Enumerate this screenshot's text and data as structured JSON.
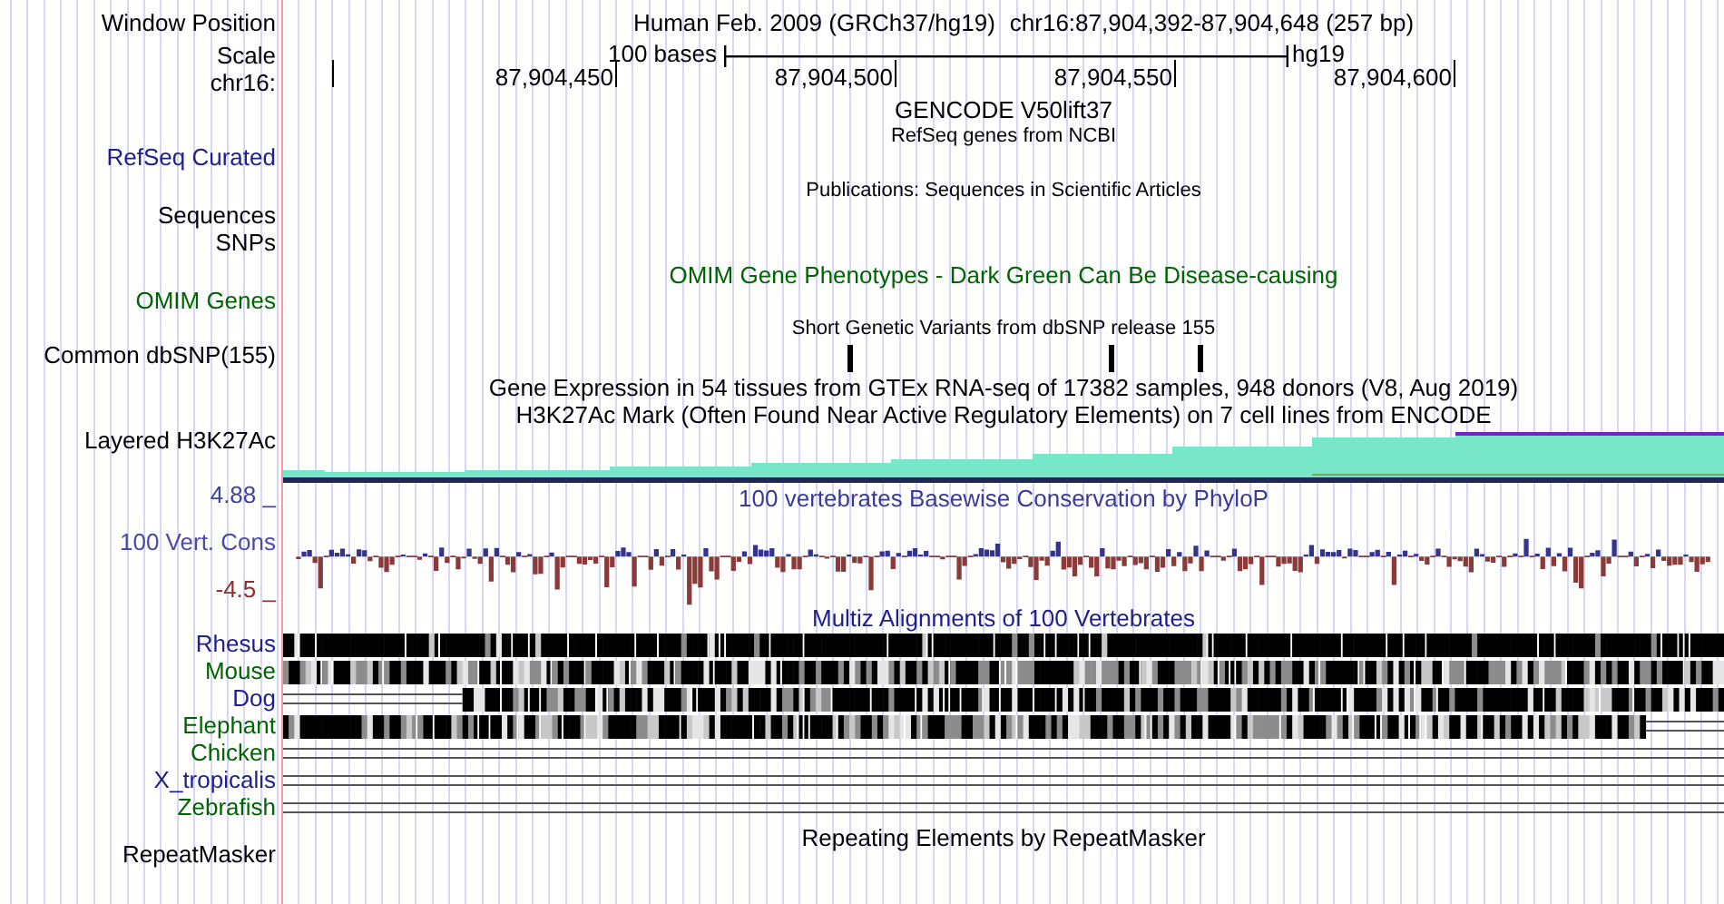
{
  "header": {
    "position_label": "Window Position",
    "assembly": "Human Feb. 2009 (GRCh37/hg19)",
    "position": "chr16:87,904,392-87,904,648 (257 bp)",
    "scale_label": "Scale",
    "scale_text": "100 bases",
    "scale_db": "hg19",
    "chrom_label": "chr16:",
    "ticks": [
      "87,904,450",
      "87,904,500",
      "87,904,550",
      "87,904,600"
    ]
  },
  "tracks": [
    {
      "kind": "gencode",
      "title": "GENCODE V50lift37"
    },
    {
      "kind": "refseq",
      "label": "RefSeq Curated",
      "color": "#20208b",
      "title": "RefSeq genes from NCBI"
    },
    {
      "kind": "pubs",
      "title": "Publications: Sequences in Scientific Articles"
    },
    {
      "kind": "plain",
      "label": "Sequences"
    },
    {
      "kind": "plain",
      "label": "SNPs"
    },
    {
      "kind": "omim",
      "label": "OMIM Genes",
      "color": "#006400",
      "title": "OMIM Gene Phenotypes - Dark Green Can Be Disease-causing"
    },
    {
      "kind": "dbsnp",
      "label": "Common dbSNP(155)",
      "title": "Short Genetic Variants from dbSNP release 155"
    },
    {
      "kind": "gtex",
      "title": "Gene Expression in 54 tissues from GTEx RNA-seq of 17382 samples, 948 donors (V8, Aug 2019)"
    },
    {
      "kind": "h3k27ac",
      "label": "Layered H3K27Ac",
      "title": "H3K27Ac Mark (Often Found Near Active Regulatory Elements) on 7 cell lines from ENCODE"
    },
    {
      "kind": "phylop",
      "label": "100 Vert. Cons",
      "max": "4.88 _",
      "min": "-4.5 _",
      "title": "100 vertebrates Basewise Conservation by PhyloP"
    },
    {
      "kind": "multiz",
      "title": "Multiz Alignments of 100 Vertebrates",
      "species": [
        {
          "name": "Rhesus",
          "color": "#20208b",
          "kind": "blocks"
        },
        {
          "name": "Mouse",
          "color": "#006400",
          "kind": "blocks"
        },
        {
          "name": "Dog",
          "color": "#20208b",
          "kind": "blocks"
        },
        {
          "name": "Elephant",
          "color": "#006400",
          "kind": "blocks"
        },
        {
          "name": "Chicken",
          "color": "#006400",
          "kind": "lines"
        },
        {
          "name": "X_tropicalis",
          "color": "#20208b",
          "kind": "lines"
        },
        {
          "name": "Zebrafish",
          "color": "#006400",
          "kind": "lines"
        }
      ]
    },
    {
      "kind": "repeat",
      "label": "RepeatMasker",
      "title": "Repeating Elements by RepeatMasker"
    }
  ]
}
